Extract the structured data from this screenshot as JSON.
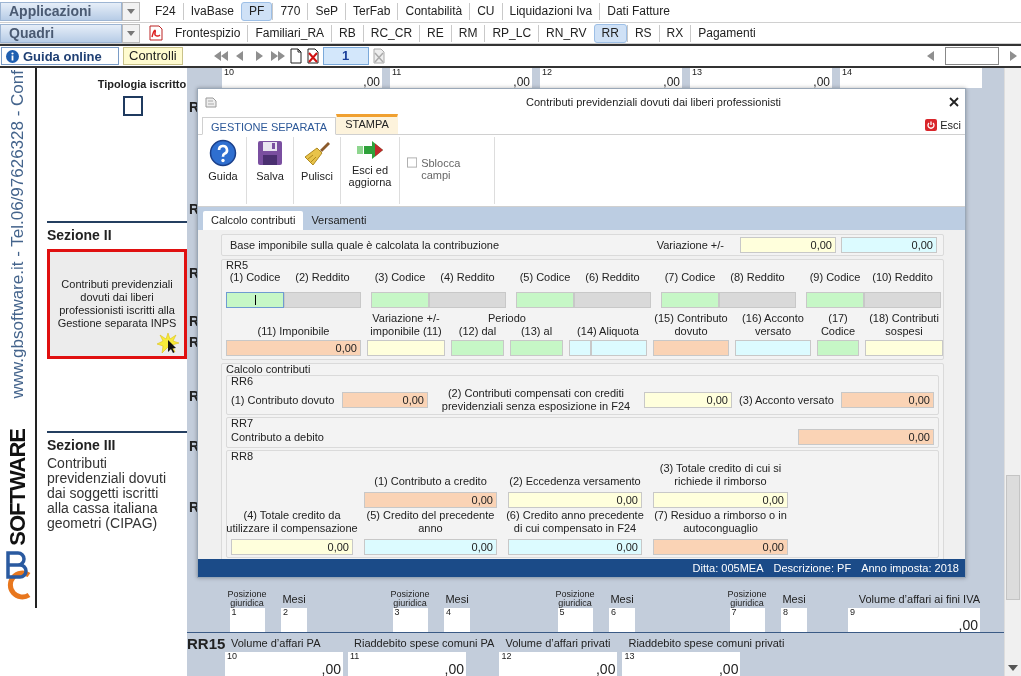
{
  "app_menu": {
    "applicazioni": "Applicazioni",
    "app_tabs": [
      {
        "label": "F24",
        "selected": false
      },
      {
        "label": "IvaBase",
        "selected": false
      },
      {
        "label": "PF",
        "selected": true
      },
      {
        "label": "770",
        "selected": false
      },
      {
        "label": "SeP",
        "selected": false
      },
      {
        "label": "TerFab",
        "selected": false
      },
      {
        "label": "Contabilità",
        "selected": false
      },
      {
        "label": "CU",
        "selected": false
      },
      {
        "label": "Liquidazioni Iva",
        "selected": false
      },
      {
        "label": "Dati Fatture",
        "selected": false
      }
    ],
    "quadri": "Quadri",
    "quadri_tabs": [
      {
        "label": "Frontespizio",
        "selected": false
      },
      {
        "label": "Familiari_RA",
        "selected": false
      },
      {
        "label": "RB",
        "selected": false
      },
      {
        "label": "RC_CR",
        "selected": false
      },
      {
        "label": "RE",
        "selected": false
      },
      {
        "label": "RM",
        "selected": false
      },
      {
        "label": "RP_LC",
        "selected": false
      },
      {
        "label": "RN_RV",
        "selected": false
      },
      {
        "label": "RR",
        "selected": true
      },
      {
        "label": "RS",
        "selected": false
      },
      {
        "label": "RX",
        "selected": false
      },
      {
        "label": "Pagamenti",
        "selected": false
      }
    ]
  },
  "nav": {
    "guida_online": "Guida online",
    "controlli": "Controlli",
    "page": "1"
  },
  "sidebar": {
    "contact": "www.gbsoftware.it - Tel.06/97626328 - Conf",
    "logo_text": "SOFTWARE"
  },
  "left_column": {
    "tipologia_label": "Tipologia iscritto",
    "tipologia_checked": false,
    "section_2_title": "Sezione II",
    "section_2_box": "Contributi previdenziali dovuti dai liberi professionisti iscritti alla Gestione separata INPS",
    "section_3_title": "Sezione III",
    "section_3_text": "Contributi previdenziali dovuti dai soggetti iscritti alla cassa italiana geometri (CIPAG)"
  },
  "form": {
    "top_fields": [
      {
        "number": "10",
        "value": ",00"
      },
      {
        "number": "11",
        "value": ",00"
      },
      {
        "number": "12",
        "value": ",00"
      },
      {
        "number": "13",
        "value": ",00"
      },
      {
        "number": "14"
      }
    ],
    "row_marks": [
      "R",
      "R",
      "R",
      "R",
      "R",
      "R",
      "R",
      "R"
    ],
    "position_groups": [
      {
        "position_label": "Posizione giuridica",
        "position_number": "1",
        "months_label": "Mesi",
        "months_number": "2"
      },
      {
        "position_label": "Posizione giuridica",
        "position_number": "3",
        "months_label": "Mesi",
        "months_number": "4"
      },
      {
        "position_label": "Posizione giuridica",
        "position_number": "5",
        "months_label": "Mesi",
        "months_number": "6"
      },
      {
        "position_label": "Posizione giuridica",
        "position_number": "7",
        "months_label": "Mesi",
        "months_number": "8"
      }
    ],
    "volume_iva": {
      "label": "Volume d’affari ai fini IVA",
      "number": "9",
      "value": ",00"
    },
    "rr15": {
      "label": "RR15",
      "fields": [
        {
          "label": "Volume d’affari PA",
          "number": "10",
          "value": ",00"
        },
        {
          "label": "Riaddebito spese comuni PA",
          "number": "11",
          "value": ",00"
        },
        {
          "label": "Volume d’affari privati",
          "number": "12",
          "value": ",00"
        },
        {
          "label": "Riaddebito spese comuni privati",
          "number": "13",
          "value": ",00"
        }
      ]
    }
  },
  "dialog": {
    "title": "Contributi previdenziali dovuti dai liberi professionisti",
    "ribbon_tabs": [
      {
        "label": "GESTIONE SEPARATA",
        "selected": true,
        "contextual": false
      },
      {
        "label": "STAMPA",
        "selected": false,
        "contextual": true
      }
    ],
    "exit": "Esci",
    "ribbon_buttons": [
      {
        "kind": "help",
        "label": "Guida"
      },
      {
        "kind": "save",
        "label": "Salva"
      },
      {
        "kind": "clear",
        "label": "Pulisci"
      },
      {
        "kind": "exit_update",
        "label": "Esci ed aggiorna"
      }
    ],
    "unlock": {
      "label": "Sblocca campi",
      "checked": false
    },
    "tabs": [
      {
        "label": "Calcolo contributi",
        "selected": true
      },
      {
        "label": "Versamenti",
        "selected": false
      }
    ],
    "base": {
      "label": "Base imponibile sulla quale è calcolata la contribuzione",
      "variation_label": "Variazione +/-",
      "fields": [
        {
          "color": "#ffffdc",
          "value": "0,00"
        },
        {
          "color": "#dcfbff",
          "value": "0,00"
        }
      ]
    },
    "rr5": {
      "title": "RR5",
      "pairs": [
        {
          "code": {
            "label": "(1) Codice",
            "color": "#c6f7c6",
            "focused": true
          },
          "income": {
            "label": "(2) Reddito",
            "color": "#d9d9d9",
            "focused": false
          }
        },
        {
          "code": {
            "label": "(3) Codice",
            "color": "#c6f7c6",
            "focused": false
          },
          "income": {
            "label": "(4) Reddito",
            "color": "#d9d9d9",
            "focused": false
          }
        },
        {
          "code": {
            "label": "(5) Codice",
            "color": "#c6f7c6",
            "focused": false
          },
          "income": {
            "label": "(6) Reddito",
            "color": "#d9d9d9",
            "focused": false
          }
        },
        {
          "code": {
            "label": "(7) Codice",
            "color": "#c6f7c6",
            "focused": false
          },
          "income": {
            "label": "(8) Reddito",
            "color": "#d9d9d9",
            "focused": false
          }
        },
        {
          "code": {
            "label": "(9) Codice",
            "color": "#c6f7c6",
            "focused": false
          },
          "income": {
            "label": "(10) Reddito",
            "color": "#d9d9d9",
            "focused": false
          }
        }
      ],
      "period_label": "Periodo",
      "items": [
        {
          "label": "(11) Imponibile",
          "fields": [
            {
              "color": "#fad3b5",
              "value": "0,00"
            }
          ]
        },
        {
          "label": "Variazione +/- imponibile (11)",
          "fields": [
            {
              "color": "#ffffdc"
            }
          ]
        },
        {
          "label": "(12) dal",
          "fields": [
            {
              "color": "#c6f7c6"
            }
          ]
        },
        {
          "label": "(13) al",
          "fields": [
            {
              "color": "#c6f7c6"
            }
          ]
        },
        {
          "label": "(14) Aliquota",
          "fields": [
            {
              "color": "#dcfbff"
            },
            {
              "color": "#dcfbff"
            }
          ]
        },
        {
          "label": "(15) Contributo dovuto",
          "fields": [
            {
              "color": "#fad3b5"
            }
          ]
        },
        {
          "label": "(16) Acconto versato",
          "fields": [
            {
              "color": "#dcfbff"
            }
          ]
        },
        {
          "label": "(17) Codice",
          "fields": [
            {
              "color": "#c6f7c6"
            }
          ]
        },
        {
          "label": "(18) Contributi sospesi",
          "fields": [
            {
              "color": "#ffffdc"
            }
          ]
        }
      ]
    },
    "calc": {
      "title": "Calcolo contributi",
      "rr6": {
        "title": "RR6",
        "items": [
          {
            "label": "(1) Contributo dovuto",
            "field": {
              "color": "#fad3b5",
              "value": "0,00"
            }
          },
          {
            "label": "(2) Contributi compensati con crediti previdenziali senza esposizione in F24",
            "field": {
              "color": "#ffffdc",
              "value": "0,00"
            }
          },
          {
            "label": "(3) Acconto versato",
            "field": {
              "color": "#fad3b5",
              "value": "0,00"
            }
          }
        ]
      },
      "rr7": {
        "title": "RR7",
        "label": "Contributo a debito",
        "field": {
          "color": "#fad3b5",
          "value": "0,00"
        }
      },
      "rr8": {
        "title": "RR8",
        "rows": [
          [
            "",
            {
              "label": "(1) Contributo a credito",
              "field": {
                "color": "#fad3b5",
                "value": "0,00"
              }
            },
            {
              "label": "(2) Eccedenza versamento",
              "field": {
                "color": "#ffffdc",
                "value": "0,00"
              }
            },
            {
              "label": "(3) Totale credito di cui si richiede il rimborso",
              "field": {
                "color": "#ffffdc",
                "value": "0,00"
              }
            }
          ],
          [
            {
              "label": "(4) Totale credito da utilizzare il compensazione",
              "field": {
                "color": "#ffffdc",
                "value": "0,00"
              }
            },
            {
              "label": "(5) Credito del precedente anno",
              "field": {
                "color": "#dcfbff",
                "value": "0,00"
              }
            },
            {
              "label": "(6) Credito anno precedente di cui compensato in F24",
              "field": {
                "color": "#dcfbff",
                "value": "0,00"
              }
            },
            {
              "label": "(7) Residuo a rimborso o in autoconguaglio",
              "field": {
                "color": "#fad3b5",
                "value": "0,00"
              }
            }
          ]
        ]
      }
    },
    "status": [
      "Ditta: 005MEA",
      "Descrizione: PF",
      "Anno imposta: 2018"
    ]
  }
}
